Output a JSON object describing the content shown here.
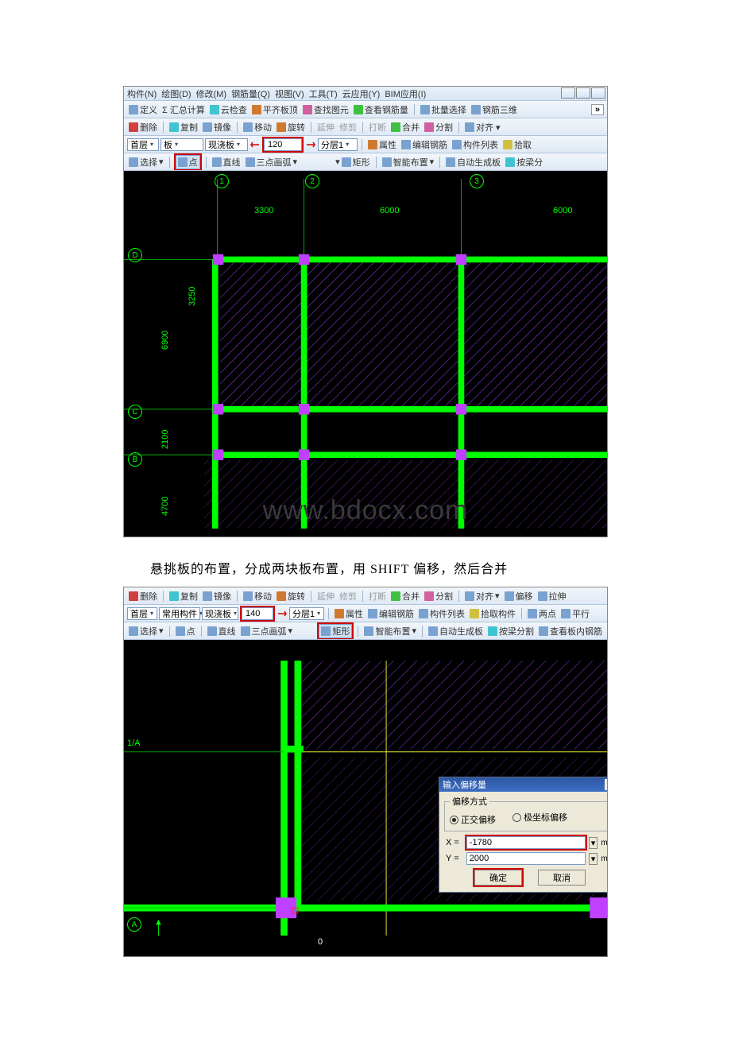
{
  "menus": [
    "构件(N)",
    "绘图(D)",
    "修改(M)",
    "钢筋量(Q)",
    "视图(V)",
    "工具(T)",
    "云应用(Y)",
    "BIM应用(I)"
  ],
  "toolbar1": {
    "define": "定义",
    "sigma": "Σ 汇总计算",
    "cloud": "云检查",
    "flat": "平齐板顶",
    "findpic": "查找图元",
    "viewrebar": "查看钢筋量",
    "batch": "批量选择",
    "rebar3d": "钢筋三维",
    "expand": "»"
  },
  "toolbar2": {
    "delete": "删除",
    "copy": "复制",
    "mirror": "镜像",
    "move": "移动",
    "rotate": "旋转",
    "extend": "延伸",
    "trim": "修剪",
    "break": "打断",
    "merge": "合并",
    "split": "分割",
    "align": "对齐 ▾"
  },
  "toolbar3": {
    "floor": "首层",
    "member": "板",
    "cast": "现浇板",
    "value120": "120",
    "layer": "分层1",
    "attr": "属性",
    "editrebar": "编辑钢筋",
    "memberlist": "构件列表",
    "pick": "拾取"
  },
  "toolbar4": {
    "select": "选择",
    "point": "点",
    "line": "直线",
    "arc3": "三点画弧",
    "rect": "矩形",
    "smart": "智能布置",
    "auto": "自动生成板",
    "byBeam": "按梁分"
  },
  "tb2_row1": {
    "delete": "删除",
    "copy": "复制",
    "mirror": "镜像",
    "move": "移动",
    "rotate": "旋转",
    "extend": "延伸",
    "trim": "修剪",
    "break": "打断",
    "merge": "合并",
    "split": "分割",
    "align": "对齐",
    "offset": "偏移",
    "stretch": "拉伸"
  },
  "tb2_row2": {
    "floor": "首层",
    "common": "常用构件",
    "cast": "现浇板",
    "value140": "140",
    "layer": "分层1",
    "attr": "属性",
    "editrebar": "编辑钢筋",
    "memberlist": "构件列表",
    "pick": "拾取构件",
    "twopoint": "两点",
    "perp": "平行"
  },
  "tb2_row3": {
    "select": "选择",
    "point": "点",
    "line": "直线",
    "arc3": "三点画弧",
    "rect": "矩形",
    "smart": "智能布置",
    "auto": "自动生成板",
    "byBeam": "按梁分割",
    "insiderebar": "查看板内钢筋"
  },
  "gridTop": {
    "cols": {
      "1": "1",
      "2": "2",
      "3": "3"
    },
    "rows": {
      "D": "D",
      "C": "C",
      "B": "B"
    },
    "dims": {
      "c12": "3300",
      "c23": "6000",
      "c34": "6000",
      "rDC_top": "3250",
      "rDC": "6900",
      "rCB": "2100",
      "rBA": "4700"
    }
  },
  "gridBot": {
    "rows": {
      "oneA": "1/A",
      "A": "A"
    },
    "origin": "0"
  },
  "caption": "悬挑板的布置，分成两块板布置，用 SHIFT 偏移，然后合并",
  "watermark": "www.bdocx.com",
  "dlg": {
    "title": "输入偏移量",
    "group": "偏移方式",
    "ortho": "正交偏移",
    "polar": "极坐标偏移",
    "xlabel": "X =",
    "ylabel": "Y =",
    "xval": "-1780",
    "yval": "2000",
    "unit": "mm",
    "ok": "确定",
    "cancel": "取消",
    "close": "×"
  }
}
